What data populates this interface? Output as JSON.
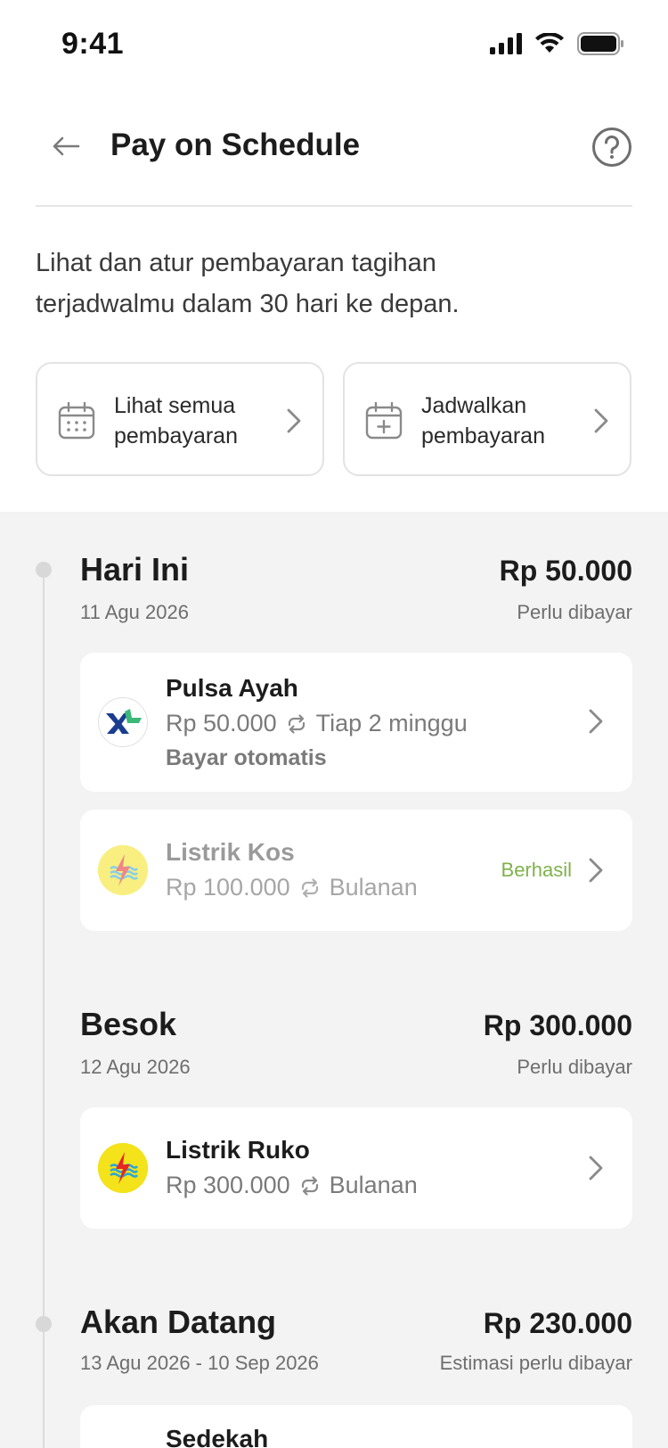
{
  "status_bar": {
    "time": "9:41"
  },
  "header": {
    "title": "Pay on Schedule"
  },
  "intro": {
    "text": "Lihat dan atur pembayaran tagihan terjadwalmu dalam 30 hari ke depan."
  },
  "actions": [
    {
      "label": "Lihat semua pembayaran",
      "icon": "calendar-grid-icon"
    },
    {
      "label": "Jadwalkan pembayaran",
      "icon": "calendar-plus-icon"
    }
  ],
  "groups": [
    {
      "title": "Hari Ini",
      "date": "11 Agu 2026",
      "amount": "Rp 50.000",
      "status": "Perlu dibayar",
      "bills": [
        {
          "name": "Pulsa Ayah",
          "amount": "Rp 50.000",
          "frequency": "Tiap 2 minggu",
          "auto": "Bayar otomatis",
          "logo": "xl-logo"
        },
        {
          "name": "Listrik Kos",
          "amount": "Rp 100.000",
          "frequency": "Bulanan",
          "badge": "Berhasil",
          "logo": "pln-logo"
        }
      ]
    },
    {
      "title": "Besok",
      "date": "12 Agu 2026",
      "amount": "Rp 300.000",
      "status": "Perlu dibayar",
      "bills": [
        {
          "name": "Listrik Ruko",
          "amount": "Rp 300.000",
          "frequency": "Bulanan",
          "logo": "pln-logo"
        }
      ]
    },
    {
      "title": "Akan Datang",
      "date": "13 Agu 2026 - 10 Sep 2026",
      "amount": "Rp 230.000",
      "status": "Estimasi perlu dibayar",
      "bills": [
        {
          "name": "Sedekah"
        }
      ]
    }
  ],
  "colors": {
    "success": "#7fb24a",
    "timeline_bg": "#f3f3f3",
    "pln_yellow": "#f4e21a",
    "xl_blue": "#1a3d8f",
    "xl_green": "#3cb878"
  }
}
